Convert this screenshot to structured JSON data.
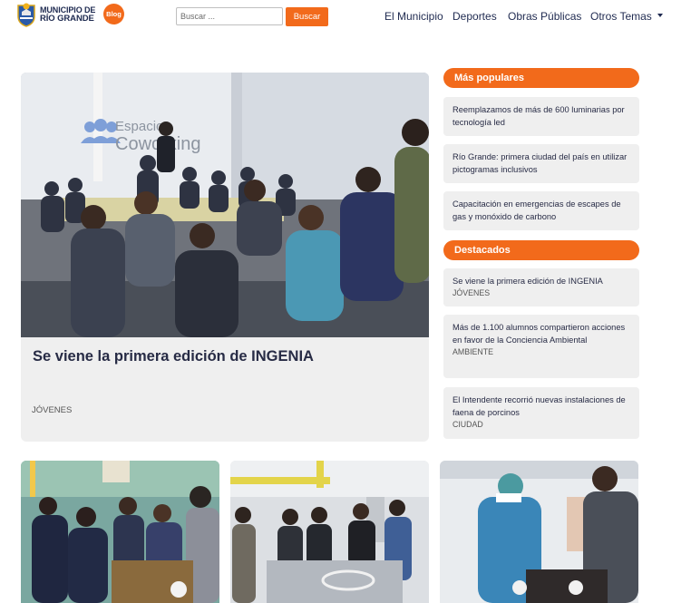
{
  "header": {
    "logo_line1": "MUNICIPIO DE",
    "logo_line2": "RÍO GRANDE",
    "logo_badge": "Blog",
    "search_placeholder": "Buscar ...",
    "search_button": "Buscar",
    "nav": [
      "El Municipio",
      "Deportes",
      "Obras Públicas",
      "Otros Temas"
    ]
  },
  "featured": {
    "photo_sign": "Espacio Coworking",
    "title": "Se viene la primera edición de INGENIA",
    "category": "JÓVENES"
  },
  "popular": {
    "heading": "Más populares",
    "items": [
      {
        "title": "Reemplazamos de más de 600 luminarias por tecnología led"
      },
      {
        "title": "Río Grande: primera ciudad del país en utilizar pictogramas inclusivos"
      },
      {
        "title": "Capacitación en emergencias de escapes de gas y monóxido de carbono"
      }
    ]
  },
  "highlights": {
    "heading": "Destacados",
    "items": [
      {
        "title": "Se viene la primera edición de INGENIA",
        "category": "JÓVENES"
      },
      {
        "title": "Más de 1.100 alumnos compartieron acciones en favor de la Conciencia Ambiental",
        "category": "AMBIENTE"
      },
      {
        "title": "El Intendente recorrió nuevas instalaciones de faena de porcinos",
        "category": "CIUDAD"
      }
    ]
  },
  "colors": {
    "accent": "#f26a1b",
    "text": "#272b45",
    "card_bg": "#efefef"
  }
}
